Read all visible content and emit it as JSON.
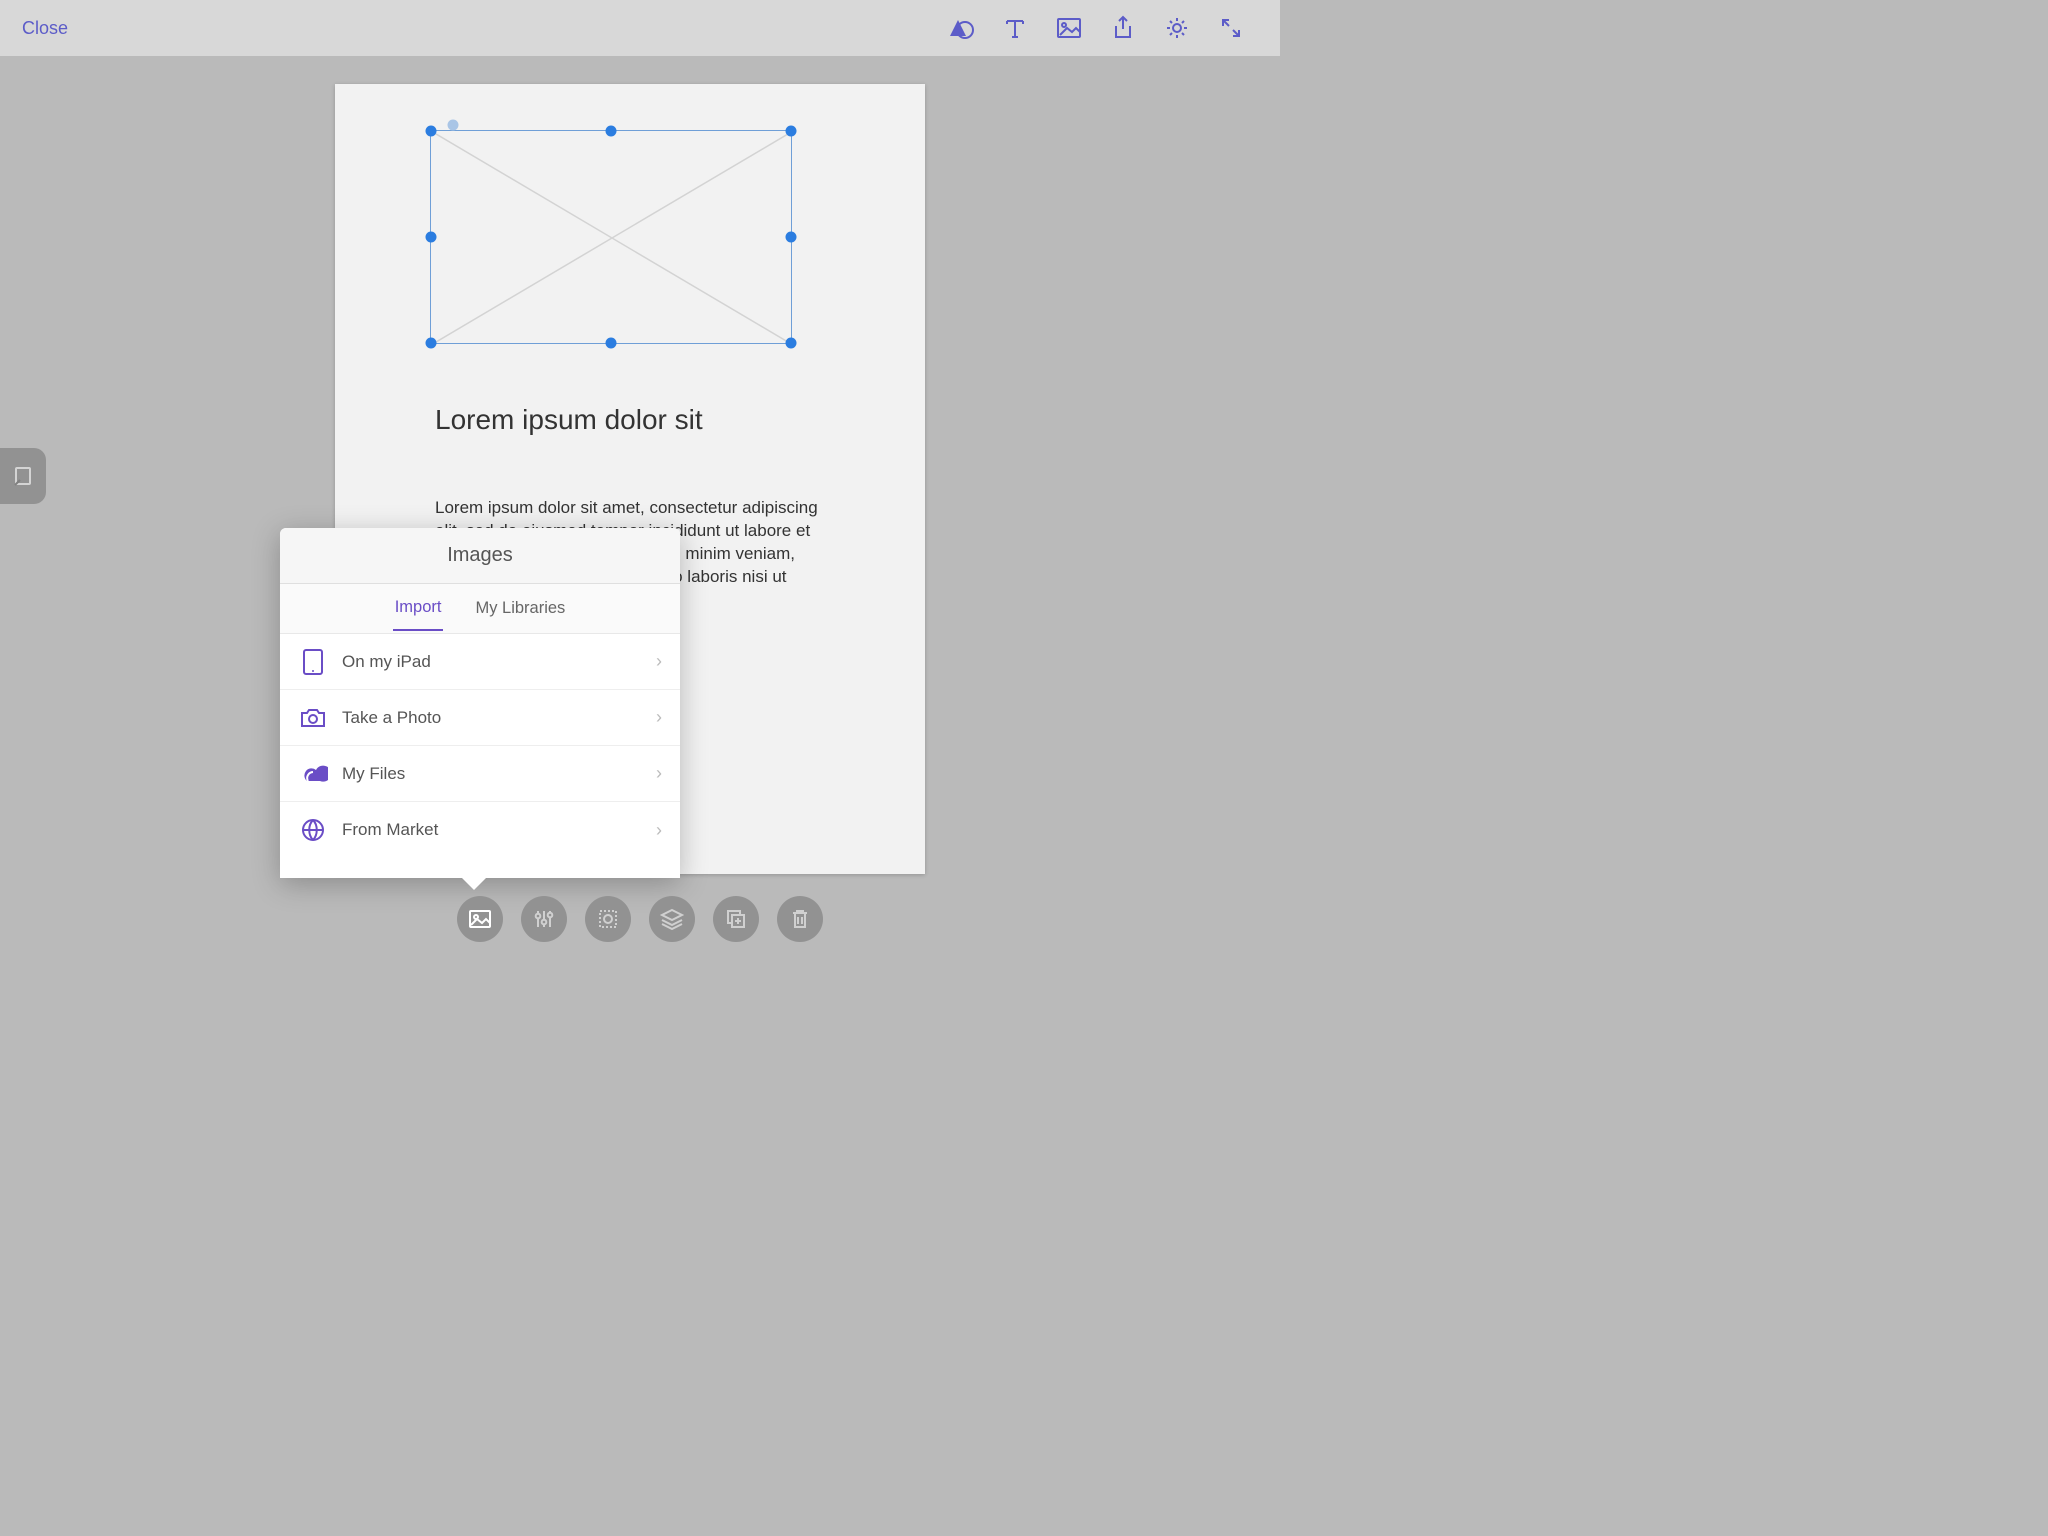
{
  "toolbar": {
    "close_label": "Close"
  },
  "document": {
    "heading": "Lorem ipsum dolor sit",
    "body": "Lorem ipsum dolor sit amet, consectetur adipiscing elit, sed do eiusmod tempor incididunt ut labore et dolore magna aliqua. Ut enim ad minim veniam, quis nostrud exercitation ullamco laboris nisi ut"
  },
  "popover": {
    "title": "Images",
    "tabs": {
      "import": "Import",
      "libraries": "My Libraries"
    },
    "items": [
      {
        "label": "On my iPad",
        "icon": "ipad-icon"
      },
      {
        "label": "Take a Photo",
        "icon": "camera-icon"
      },
      {
        "label": "My Files",
        "icon": "creative-cloud-icon"
      },
      {
        "label": "From Market",
        "icon": "globe-icon"
      }
    ]
  }
}
